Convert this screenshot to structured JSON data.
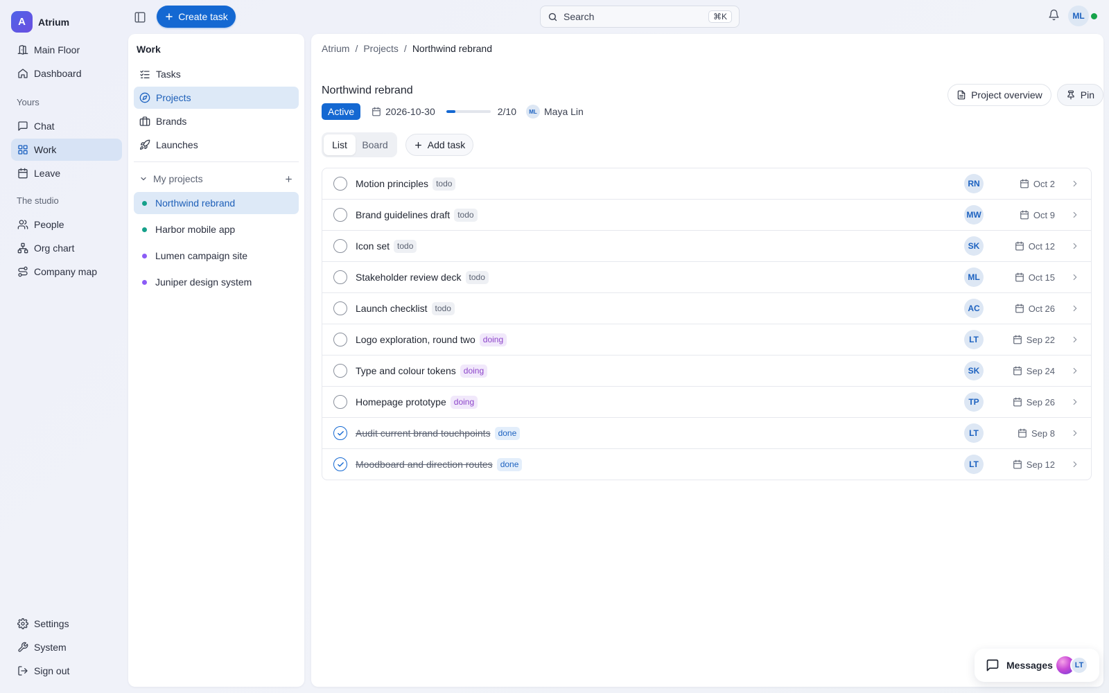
{
  "brand": {
    "initial": "A",
    "name": "Atrium"
  },
  "nav": {
    "primary": [
      {
        "label": "Main Floor",
        "icon": "door-icon"
      },
      {
        "label": "Dashboard",
        "icon": "home-icon"
      }
    ],
    "yours_label": "Yours",
    "yours": [
      {
        "label": "Chat",
        "icon": "chat-icon"
      },
      {
        "label": "Work",
        "icon": "grid-icon",
        "active": true
      },
      {
        "label": "Leave",
        "icon": "calendar-icon"
      }
    ],
    "studio_label": "The studio",
    "studio": [
      {
        "label": "People",
        "icon": "people-icon"
      },
      {
        "label": "Org chart",
        "icon": "org-chart-icon"
      },
      {
        "label": "Company map",
        "icon": "route-icon"
      }
    ],
    "footer": [
      {
        "label": "Settings",
        "icon": "gear-icon"
      },
      {
        "label": "System",
        "icon": "wrench-icon"
      },
      {
        "label": "Sign out",
        "icon": "sign-out-icon"
      }
    ]
  },
  "topbar": {
    "create_label": "Create task",
    "search_label": "Search",
    "search_shortcut": "⌘K",
    "user_initials": "ML"
  },
  "work_panel": {
    "title": "Work",
    "items": [
      {
        "label": "Tasks",
        "icon": "checklist-icon"
      },
      {
        "label": "Projects",
        "icon": "compass-icon",
        "active": true
      },
      {
        "label": "Brands",
        "icon": "briefcase-icon"
      },
      {
        "label": "Launches",
        "icon": "rocket-icon"
      }
    ],
    "group_label": "My projects",
    "projects": [
      {
        "label": "Northwind rebrand",
        "color": "#15a08a",
        "active": true
      },
      {
        "label": "Harbor mobile app",
        "color": "#15a08a"
      },
      {
        "label": "Lumen campaign site",
        "color": "#8b5cf6"
      },
      {
        "label": "Juniper design system",
        "color": "#8b5cf6"
      }
    ]
  },
  "main": {
    "breadcrumb": [
      "Atrium",
      "Projects",
      "Northwind rebrand"
    ],
    "title": "Northwind rebrand",
    "status": "Active",
    "due_date": "2026-10-30",
    "progress": 0.2,
    "progress_label": "2/10",
    "owner_initials": "ML",
    "owner_name": "Maya Lin",
    "overview_label": "Project overview",
    "pin_label": "Pin",
    "views": [
      "List",
      "Board"
    ],
    "active_view": "List",
    "add_task_label": "Add task",
    "tasks": [
      {
        "title": "Motion principles",
        "status": "todo",
        "assignee": "RN",
        "due": "Oct 2",
        "done": false
      },
      {
        "title": "Brand guidelines draft",
        "status": "todo",
        "assignee": "MW",
        "due": "Oct 9",
        "done": false
      },
      {
        "title": "Icon set",
        "status": "todo",
        "assignee": "SK",
        "due": "Oct 12",
        "done": false
      },
      {
        "title": "Stakeholder review deck",
        "status": "todo",
        "assignee": "ML",
        "due": "Oct 15",
        "done": false
      },
      {
        "title": "Launch checklist",
        "status": "todo",
        "assignee": "AC",
        "due": "Oct 26",
        "done": false
      },
      {
        "title": "Logo exploration, round two",
        "status": "doing",
        "assignee": "LT",
        "due": "Sep 22",
        "done": false
      },
      {
        "title": "Type and colour tokens",
        "status": "doing",
        "assignee": "SK",
        "due": "Sep 24",
        "done": false
      },
      {
        "title": "Homepage prototype",
        "status": "doing",
        "assignee": "TP",
        "due": "Sep 26",
        "done": false
      },
      {
        "title": "Audit current brand touchpoints",
        "status": "done",
        "assignee": "LT",
        "due": "Sep 8",
        "done": true
      },
      {
        "title": "Moodboard and direction routes",
        "status": "done",
        "assignee": "LT",
        "due": "Sep 12",
        "done": true
      }
    ]
  },
  "messages": {
    "label": "Messages",
    "avatar": "LT"
  },
  "colors": {
    "accent": "#1468d2",
    "online": "#16a34a",
    "doing": "#8c44c9"
  }
}
